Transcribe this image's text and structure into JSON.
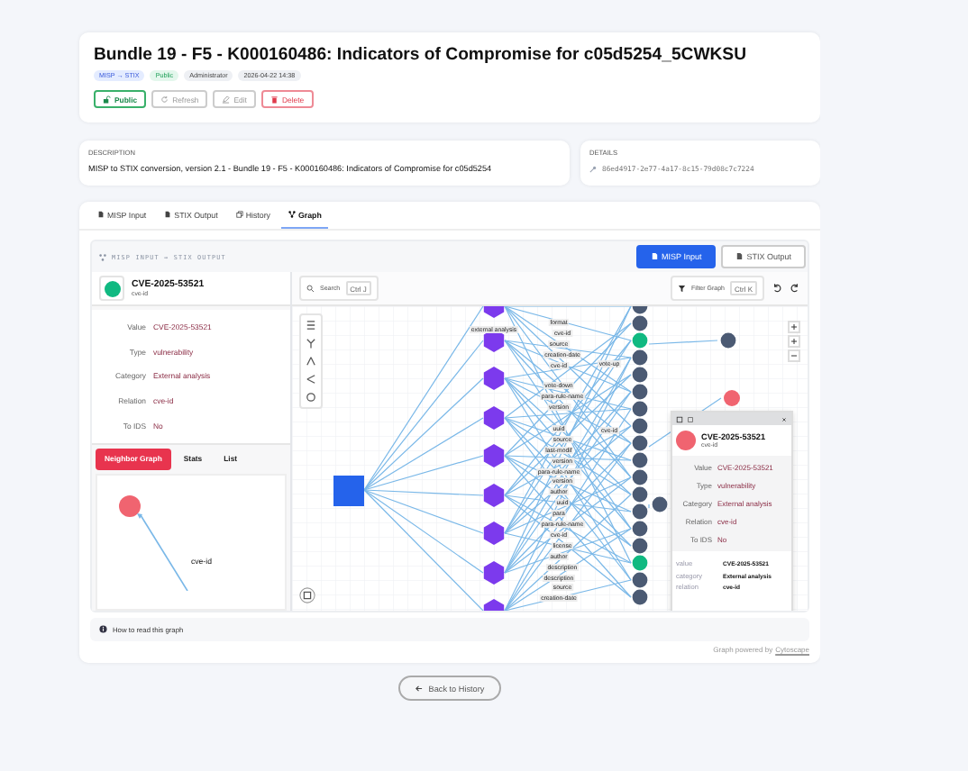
{
  "header": {
    "title": "Bundle 19 - F5 - K000160486: Indicators of Compromise for c05d5254_5CWKSU",
    "badges": [
      {
        "kind": "format",
        "label": "MISP → STIX"
      },
      {
        "kind": "status",
        "label": "Public"
      },
      {
        "kind": "user",
        "label": "Administrator"
      },
      {
        "kind": "time",
        "label": "2026-04-22 14:38"
      }
    ],
    "buttons": [
      {
        "kind": "public",
        "label": "Public",
        "disabled": false
      },
      {
        "kind": "refresh",
        "label": "Refresh",
        "disabled": true
      },
      {
        "kind": "edit",
        "label": "Edit",
        "disabled": true
      },
      {
        "kind": "delete",
        "label": "Delete",
        "disabled": false
      }
    ]
  },
  "description": {
    "heading": "DESCRIPTION",
    "text": "MISP to STIX conversion, version 2.1 - Bundle 19 - F5 - K000160486: Indicators of Compromise for c05d5254"
  },
  "details": {
    "heading": "DETAILS",
    "id": "86ed4917-2e77-4a17-8c15-79d08c7c7224"
  },
  "tabs": [
    {
      "kind": "misp",
      "label": "MISP Input",
      "selected": false
    },
    {
      "kind": "stix",
      "label": "STIX Output",
      "selected": false
    },
    {
      "kind": "history",
      "label": "History",
      "selected": false
    },
    {
      "kind": "graph",
      "label": "Graph",
      "selected": true
    }
  ],
  "graph_view": {
    "breadcrumb": "MISP INPUT → STIX OUTPUT",
    "buttons": [
      {
        "label": "MISP Input",
        "selected": true
      },
      {
        "label": "STIX Output",
        "selected": false
      }
    ],
    "search": {
      "placeholder": "Search",
      "shortcut": "Ctrl J"
    },
    "filter": {
      "label": "Filter Graph",
      "shortcut": "Ctrl K"
    },
    "node": {
      "title": "CVE-2025-53521",
      "subtitle": "cve-id",
      "properties": [
        {
          "label": "Value",
          "value": "CVE-2025-53521"
        },
        {
          "label": "Type",
          "value": "vulnerability"
        },
        {
          "label": "Category",
          "value": "External analysis"
        },
        {
          "label": "Relation",
          "value": "cve-id"
        },
        {
          "label": "To IDS",
          "value": "No"
        }
      ]
    },
    "side_tabs": [
      {
        "label": "Neighbor Graph",
        "selected": true
      },
      {
        "label": "Stats",
        "selected": false
      },
      {
        "label": "List",
        "selected": false
      }
    ],
    "neighbor_edge_label": "cve-id",
    "edge_labels": [
      "external analysis",
      "format",
      "cve-id",
      "source",
      "creation-date",
      "cve-id",
      "vote-up",
      "vote-down",
      "para-rule-name",
      "version",
      "cve-id",
      "uuid",
      "source",
      "last-modif",
      "version",
      "para-rule-name",
      "version",
      "author",
      "uuid",
      "para",
      "para-rule-name",
      "cve-id",
      "license",
      "author",
      "description",
      "description",
      "source",
      "creation-date"
    ],
    "popup": {
      "title": "CVE-2025-53521",
      "subtitle": "cve-id",
      "properties": [
        {
          "label": "Value",
          "value": "CVE-2025-53521"
        },
        {
          "label": "Type",
          "value": "vulnerability"
        },
        {
          "label": "Category",
          "value": "External analysis"
        },
        {
          "label": "Relation",
          "value": "cve-id"
        },
        {
          "label": "To IDS",
          "value": "No"
        }
      ],
      "fields": [
        {
          "key": "value",
          "value": "CVE-2025-53521"
        },
        {
          "key": "category",
          "value": "External analysis"
        },
        {
          "key": "relation",
          "value": "cve-id"
        }
      ]
    },
    "help": "How to read this graph",
    "powered_by": "Graph powered by",
    "powered_link": "Cytoscape"
  },
  "back_button": "Back to History"
}
